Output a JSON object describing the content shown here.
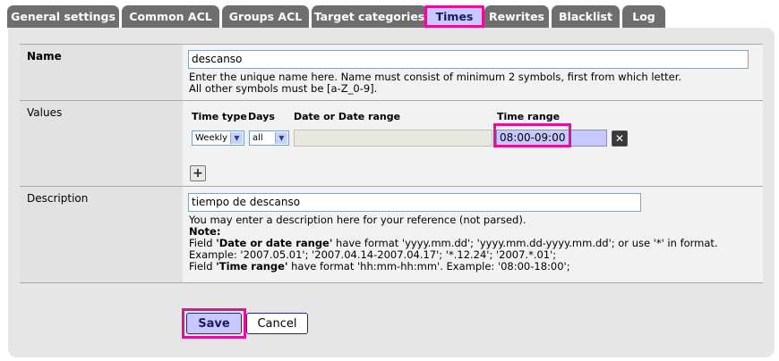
{
  "tabs": [
    {
      "label": "General settings"
    },
    {
      "label": "Common ACL"
    },
    {
      "label": "Groups ACL"
    },
    {
      "label": "Target categories"
    },
    {
      "label": "Times"
    },
    {
      "label": "Rewrites"
    },
    {
      "label": "Blacklist"
    },
    {
      "label": "Log"
    }
  ],
  "name_row": {
    "label": "Name",
    "value": "descanso",
    "help_line1": "Enter the unique name here. Name must consist of minimum 2 symbols, first from which letter.",
    "help_line2": "All other symbols must be [a-Z_0-9]."
  },
  "values_row": {
    "label": "Values",
    "col_time_type": "Time type",
    "col_days": "Days",
    "col_date": "Date or Date range",
    "col_time_range": "Time range",
    "time_type_value": "Weekly",
    "days_value": "all",
    "time_range_value": "08:00-09:00",
    "delete_icon": "delete-icon",
    "add_icon": "add-icon"
  },
  "description_row": {
    "label": "Description",
    "value": "tiempo de descanso",
    "help": "You may enter a description here for your reference (not parsed).",
    "note_label": "Note:",
    "note1_pre": "Field ",
    "note1_bold": "'Date or date range'",
    "note1_post": " have format 'yyyy.mm.dd'; 'yyyy.mm.dd-yyyy.mm.dd'; or use '*' in format.",
    "note2": "Example: '2007.05.01'; '2007.04.14-2007.04.17'; '*.12.24'; '2007.*.01';",
    "note3_pre": "Field ",
    "note3_bold": "'Time range'",
    "note3_post": " have format 'hh:mm-hh:mm'. Example: '08:00-18:00';"
  },
  "buttons": {
    "save": "Save",
    "cancel": "Cancel"
  },
  "colors": {
    "active_tab": "#c8c8ff",
    "highlight": "#e0119a",
    "tab": "#6e6e6e"
  }
}
